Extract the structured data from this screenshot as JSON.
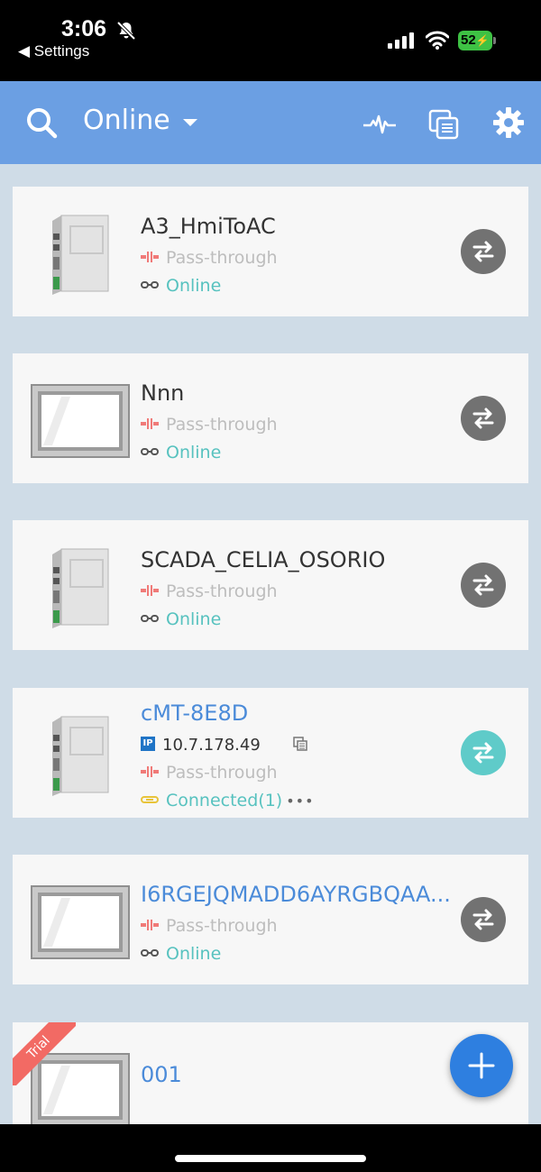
{
  "status": {
    "time": "3:06",
    "back_label": "◀ Settings",
    "battery": "52"
  },
  "header": {
    "title": "Online",
    "icons": [
      "search-icon",
      "pulse-icon",
      "copy-icon",
      "gear-icon"
    ]
  },
  "devices": [
    {
      "name": "A3_HmiToAC",
      "type": "box",
      "passthrough": "Pass-through",
      "status": "Online"
    },
    {
      "name": "Nnn",
      "type": "panel",
      "passthrough": "Pass-through",
      "status": "Online"
    },
    {
      "name": "SCADA_CELIA_OSORIO",
      "type": "box",
      "passthrough": "Pass-through",
      "status": "Online"
    },
    {
      "name": "cMT-8E8D",
      "type": "box",
      "ip_badge": "IP",
      "ip": "10.7.178.49",
      "passthrough": "Pass-through",
      "status": "Connected(1)",
      "more": "•••"
    },
    {
      "name": "I6RGEJQMADD6AYRGBQAA...",
      "type": "panel",
      "passthrough": "Pass-through",
      "status": "Online"
    },
    {
      "name": "001",
      "type": "panel",
      "badge": "Trial"
    }
  ],
  "colors": {
    "header": "#6b9fe3",
    "list_bg": "#cfdce7",
    "online": "#57c2bf",
    "link_blue": "#4b8bd9",
    "fab": "#2e7fe0"
  }
}
